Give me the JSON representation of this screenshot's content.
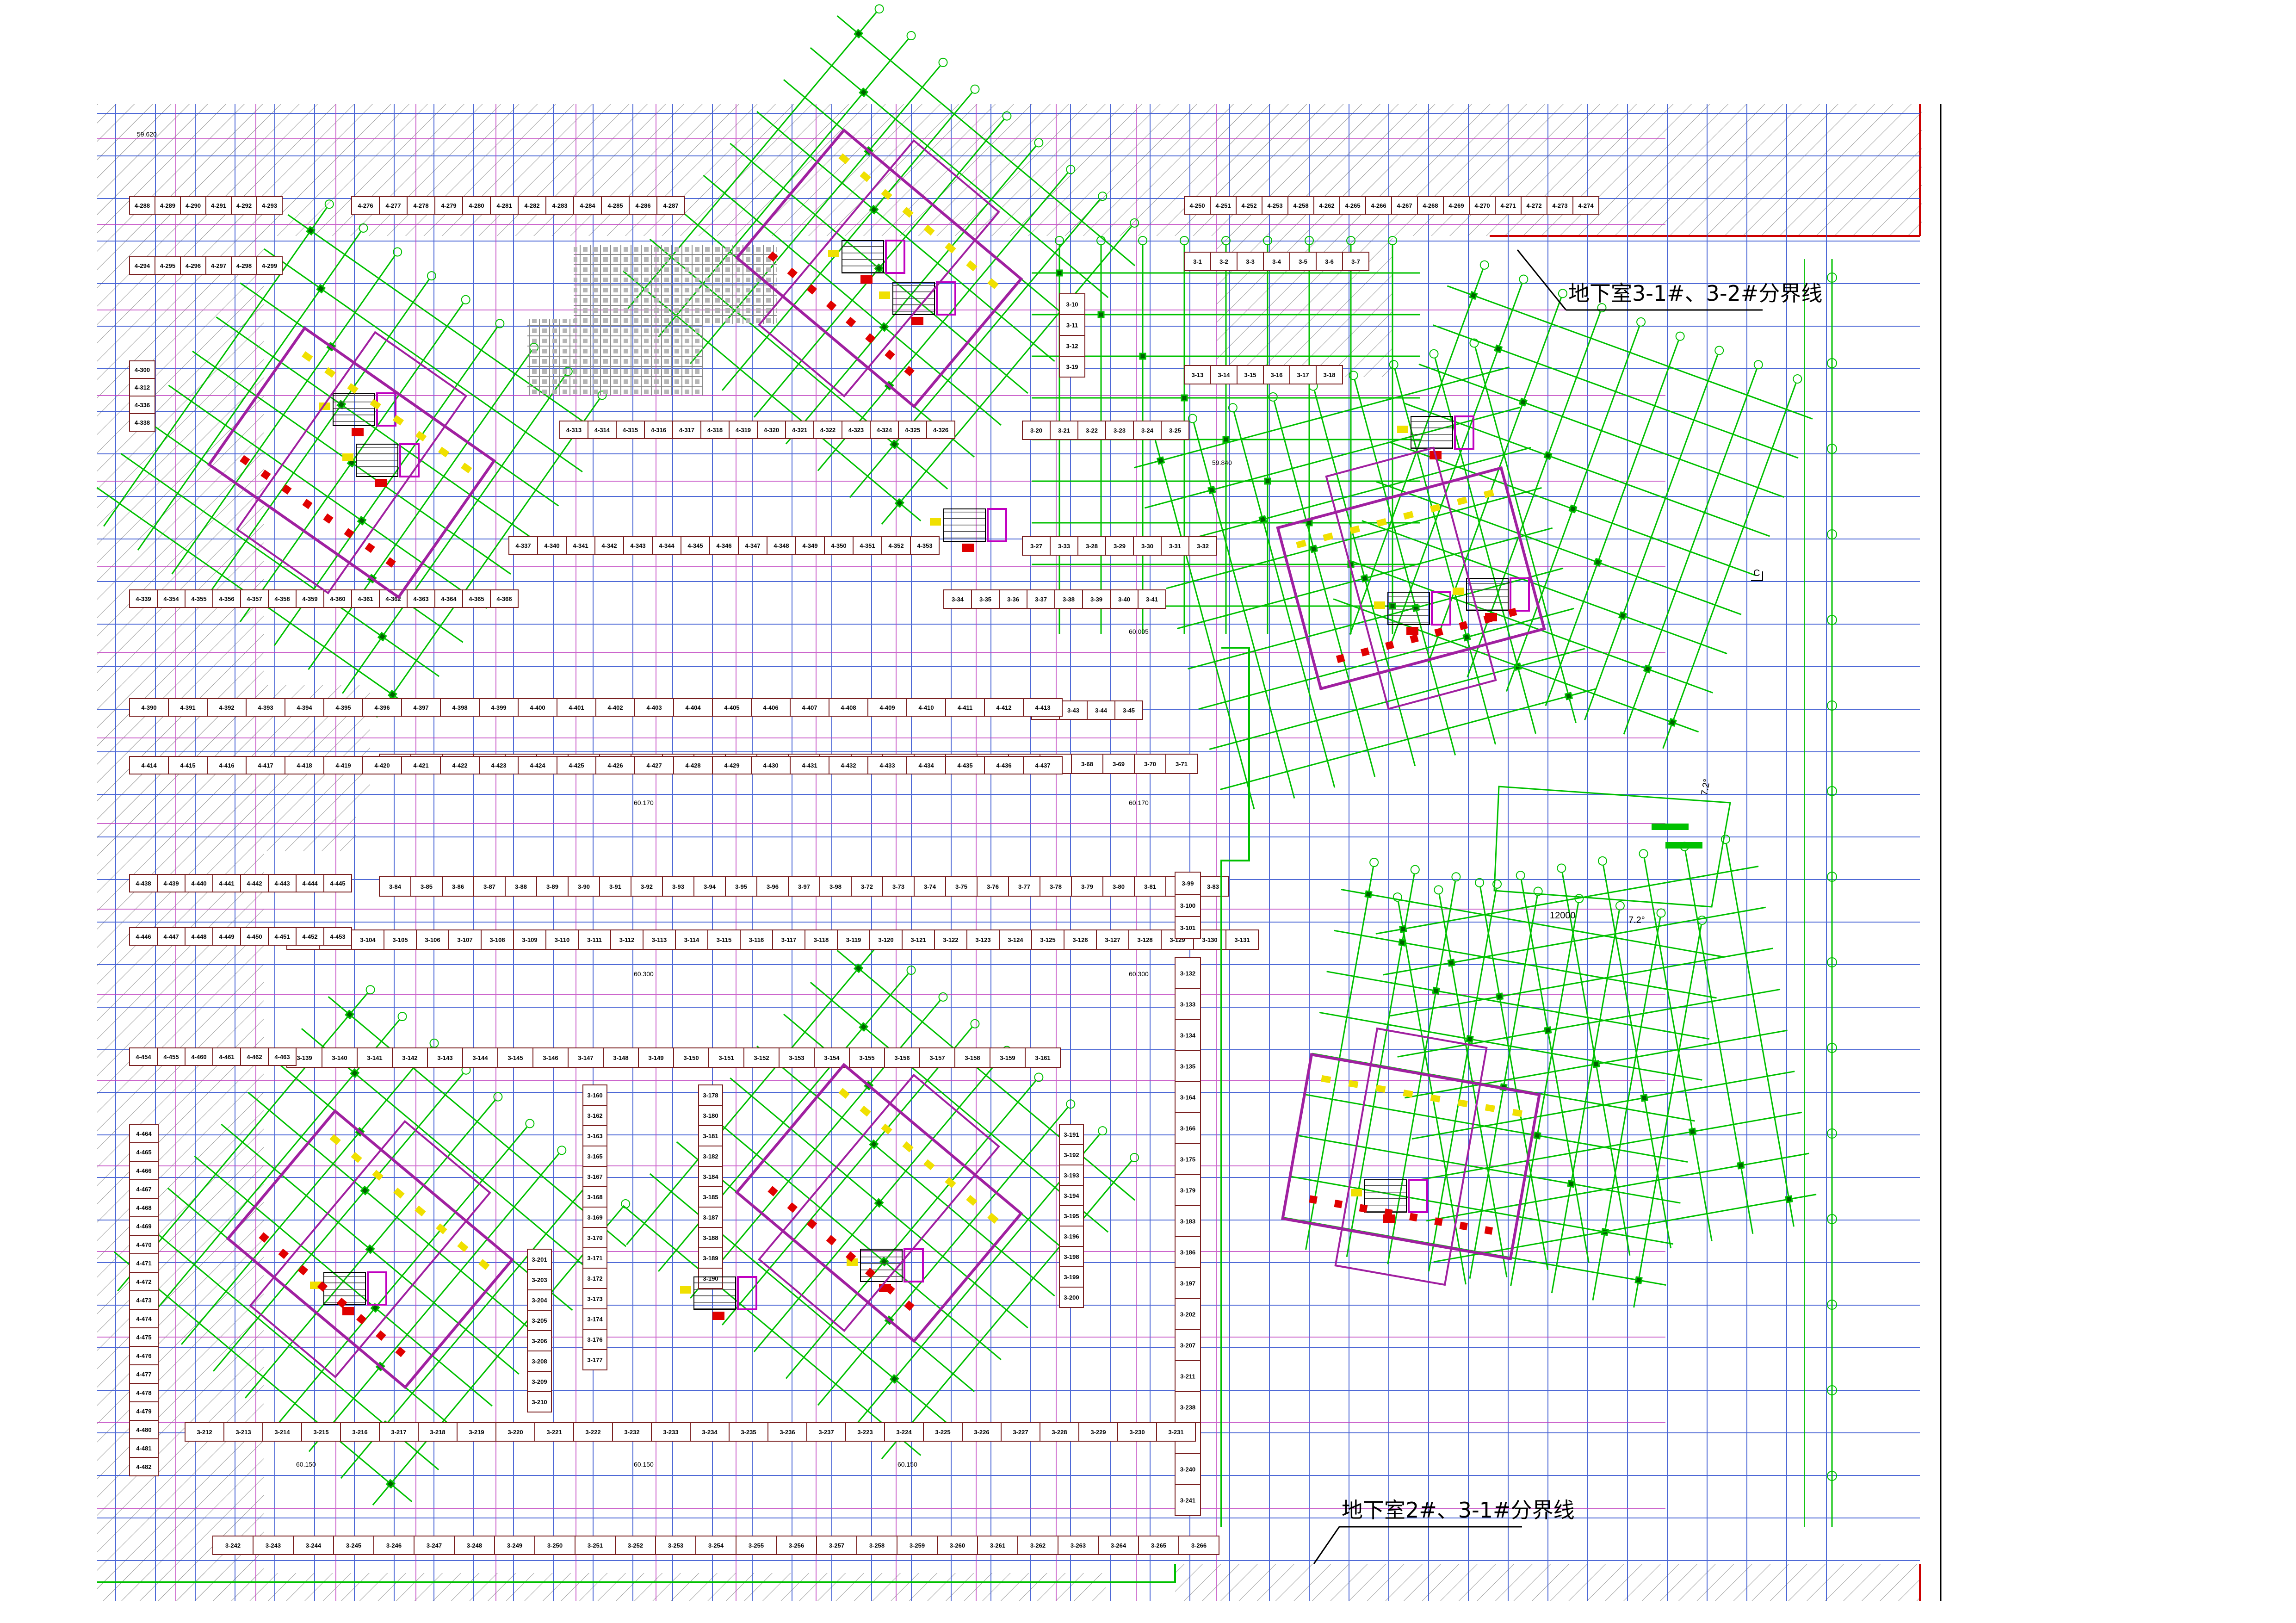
{
  "drawing": {
    "boundary_labels": {
      "b3_1_3_2": "地下室3-1#、3-2#分界线",
      "b2_3_1": "地下室2#、3-1#分界线"
    },
    "elevations": {
      "e1": "59.620",
      "e2": "59.840",
      "e3": "60.005",
      "e4": "60.170",
      "e5": "60.170",
      "e6": "60.300",
      "e7": "60.300",
      "e8": "60.150",
      "e9": "60.150",
      "e10": "60.150"
    },
    "dimensions": {
      "d1": "12000",
      "d2": "7.2°",
      "d3": "7.2°"
    },
    "marker": "C",
    "parking_row_labels": {
      "north": [
        "3-1",
        "3-2",
        "3-3",
        "3-4",
        "3-5",
        "3-6",
        "3-7"
      ],
      "east_a": [
        "3-10",
        "3-11",
        "3-12",
        "3-19"
      ],
      "mid_a": [
        "3-13",
        "3-14",
        "3-15",
        "3-16",
        "3-17",
        "3-18"
      ],
      "mid_b": [
        "3-20",
        "3-21",
        "3-22",
        "3-23",
        "3-24",
        "3-25"
      ],
      "mid_c": [
        "3-27",
        "3-33",
        "3-28",
        "3-29",
        "3-30",
        "3-31",
        "3-32"
      ],
      "mid_d": [
        "3-34",
        "3-35",
        "3-36",
        "3-37",
        "3-38",
        "3-39",
        "3-40",
        "3-41"
      ],
      "mid_e": [
        "3-42",
        "3-43",
        "3-44",
        "3-45"
      ],
      "row_46": [
        "3-46",
        "3-47",
        "3-48",
        "3-49",
        "3-50",
        "3-51",
        "3-52",
        "3-53",
        "3-54",
        "3-55",
        "3-56",
        "3-57",
        "3-58",
        "3-59",
        "3-60",
        "3-61",
        "3-62",
        "3-63",
        "3-64",
        "3-65",
        "3-66",
        "3-67",
        "3-68",
        "3-69",
        "3-70",
        "3-71"
      ],
      "row_84": [
        "3-84",
        "3-85",
        "3-86",
        "3-87",
        "3-88",
        "3-89",
        "3-90",
        "3-91",
        "3-92",
        "3-93",
        "3-94",
        "3-95",
        "3-96",
        "3-97",
        "3-98",
        "3-72",
        "3-73",
        "3-74",
        "3-75",
        "3-76",
        "3-77",
        "3-78",
        "3-79",
        "3-80",
        "3-81",
        "3-82",
        "3-83"
      ],
      "row_99": [
        "3-99",
        "3-100",
        "3-101"
      ],
      "row_102": [
        "3-102",
        "3-103",
        "3-104",
        "3-105",
        "3-106",
        "3-107",
        "3-108",
        "3-109",
        "3-110",
        "3-111",
        "3-112",
        "3-113",
        "3-114",
        "3-115",
        "3-116",
        "3-117",
        "3-118",
        "3-119",
        "3-120",
        "3-121",
        "3-122",
        "3-123",
        "3-124",
        "3-125",
        "3-126",
        "3-127",
        "3-128",
        "3-129",
        "3-130",
        "3-131"
      ],
      "east_col": [
        "3-132",
        "3-133",
        "3-134",
        "3-135",
        "3-164",
        "3-166",
        "3-175",
        "3-179",
        "3-183",
        "3-186",
        "3-197",
        "3-202",
        "3-207",
        "3-211",
        "3-238",
        "3-239",
        "3-240",
        "3-241"
      ],
      "row_139": [
        "3-139",
        "3-140",
        "3-141",
        "3-142",
        "3-143",
        "3-144",
        "3-145",
        "3-146",
        "3-147",
        "3-148",
        "3-149",
        "3-150",
        "3-151",
        "3-152",
        "3-153",
        "3-154",
        "3-155",
        "3-156",
        "3-157",
        "3-158",
        "3-159",
        "3-161"
      ],
      "row_212": [
        "3-212",
        "3-213",
        "3-214",
        "3-215",
        "3-216",
        "3-217",
        "3-218",
        "3-219",
        "3-220",
        "3-221",
        "3-222",
        "3-232",
        "3-233",
        "3-234",
        "3-235",
        "3-236",
        "3-237",
        "3-223",
        "3-224",
        "3-225",
        "3-226",
        "3-227",
        "3-228",
        "3-229",
        "3-230",
        "3-231"
      ],
      "row_242": [
        "3-242",
        "3-243",
        "3-244",
        "3-245",
        "3-246",
        "3-247",
        "3-248",
        "3-249",
        "3-250",
        "3-251",
        "3-252",
        "3-253",
        "3-254",
        "3-255",
        "3-256",
        "3-257",
        "3-258",
        "3-259",
        "3-260",
        "3-261",
        "3-262",
        "3-263",
        "3-264",
        "3-265",
        "3-266"
      ],
      "west_4": [
        "4-288",
        "4-289",
        "4-290",
        "4-291",
        "4-292",
        "4-293",
        "4-294",
        "4-295",
        "4-296",
        "4-297",
        "4-298",
        "4-299",
        "4-300",
        "4-312",
        "4-336",
        "4-338",
        "4-339",
        "4-354",
        "4-355",
        "4-356",
        "4-357",
        "4-358",
        "4-359",
        "4-360",
        "4-361",
        "4-362",
        "4-363",
        "4-364",
        "4-365",
        "4-366",
        "4-367",
        "4-368",
        "4-369",
        "4-370",
        "4-371",
        "4-372",
        "4-373",
        "4-374",
        "4-375",
        "4-376",
        "4-377",
        "4-378",
        "4-379",
        "4-380",
        "4-381",
        "4-382",
        "4-383",
        "4-384"
      ],
      "north_4": [
        "4-276",
        "4-277",
        "4-278",
        "4-279",
        "4-280",
        "4-281",
        "4-282",
        "4-283",
        "4-284",
        "4-285",
        "4-286",
        "4-287",
        "4-250",
        "4-251",
        "4-252",
        "4-253",
        "4-258",
        "4-262",
        "4-265",
        "4-266",
        "4-267",
        "4-268",
        "4-269",
        "4-270",
        "4-271",
        "4-272",
        "4-273",
        "4-274"
      ],
      "mid_4": [
        "4-313",
        "4-314",
        "4-315",
        "4-316",
        "4-317",
        "4-318",
        "4-319",
        "4-320",
        "4-321",
        "4-322",
        "4-323",
        "4-324",
        "4-325",
        "4-326",
        "4-337",
        "4-340",
        "4-341",
        "4-342",
        "4-343",
        "4-344",
        "4-345",
        "4-346",
        "4-347",
        "4-348",
        "4-349",
        "4-350",
        "4-351",
        "4-352",
        "4-353"
      ],
      "west_lower_4": [
        "4-390",
        "4-391",
        "4-392",
        "4-393",
        "4-394",
        "4-395",
        "4-396",
        "4-397",
        "4-398",
        "4-399",
        "4-400",
        "4-401",
        "4-402",
        "4-403",
        "4-404",
        "4-405",
        "4-406",
        "4-407",
        "4-408",
        "4-409",
        "4-410",
        "4-411",
        "4-412",
        "4-413",
        "4-414",
        "4-415",
        "4-416",
        "4-417",
        "4-418",
        "4-419",
        "4-420",
        "4-421",
        "4-422",
        "4-423",
        "4-424",
        "4-425",
        "4-426",
        "4-427",
        "4-428",
        "4-429",
        "4-430",
        "4-431",
        "4-432",
        "4-433",
        "4-434",
        "4-435",
        "4-436",
        "4-437",
        "4-438",
        "4-439",
        "4-440",
        "4-441",
        "4-442",
        "4-443",
        "4-444",
        "4-445",
        "4-446",
        "4-447",
        "4-448",
        "4-449",
        "4-450",
        "4-451",
        "4-452",
        "4-453",
        "4-454",
        "4-455",
        "4-460",
        "4-461",
        "4-462",
        "4-463",
        "4-464",
        "4-465",
        "4-466",
        "4-467",
        "4-468",
        "4-469",
        "4-470",
        "4-471",
        "4-472",
        "4-473",
        "4-474",
        "4-475",
        "4-476",
        "4-477",
        "4-478",
        "4-479",
        "4-480",
        "4-481",
        "4-482"
      ],
      "core": [
        "3-160",
        "3-162",
        "3-163",
        "3-165",
        "3-167",
        "3-168",
        "3-169",
        "3-170",
        "3-171",
        "3-172",
        "3-173",
        "3-174",
        "3-176",
        "3-177",
        "3-178",
        "3-180",
        "3-181",
        "3-182",
        "3-184",
        "3-185",
        "3-187",
        "3-188",
        "3-189",
        "3-190",
        "3-191",
        "3-192",
        "3-193",
        "3-194",
        "3-195",
        "3-196",
        "3-198",
        "3-199",
        "3-200",
        "3-201",
        "3-203",
        "3-204",
        "3-205",
        "3-206",
        "3-208",
        "3-209",
        "3-210"
      ]
    }
  }
}
